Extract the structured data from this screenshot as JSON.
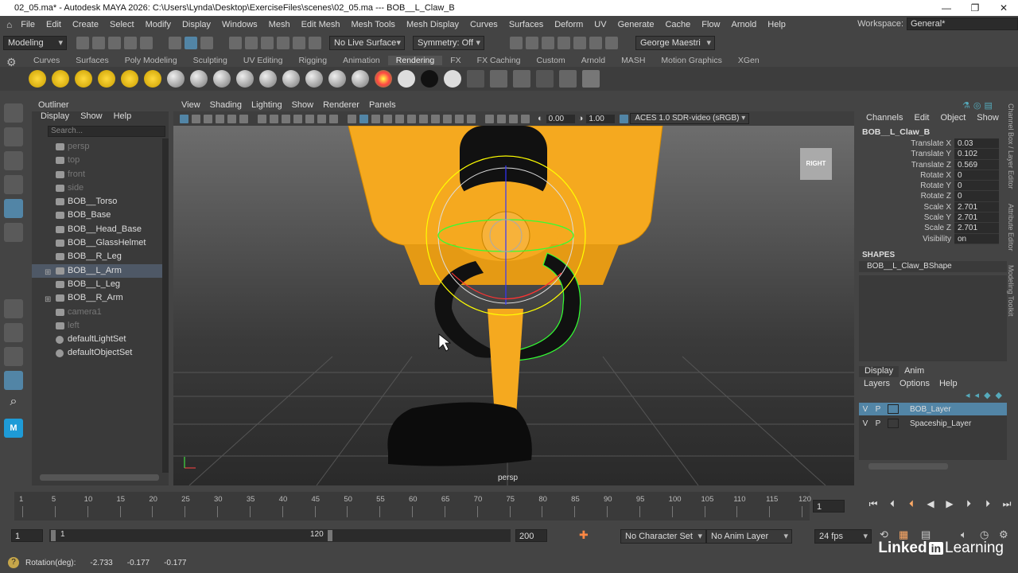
{
  "window": {
    "title": "02_05.ma* - Autodesk MAYA 2026: C:\\Users\\Lynda\\Desktop\\ExerciseFiles\\scenes\\02_05.ma   ---   BOB__L_Claw_B"
  },
  "menubar": [
    "File",
    "Edit",
    "Create",
    "Select",
    "Modify",
    "Display",
    "Windows",
    "Mesh",
    "Edit Mesh",
    "Mesh Tools",
    "Mesh Display",
    "Curves",
    "Surfaces",
    "Deform",
    "UV",
    "Generate",
    "Cache",
    "Flow",
    "Arnold",
    "Help"
  ],
  "workspace": {
    "label": "Workspace:",
    "value": "General*"
  },
  "statusline": {
    "mode": "Modeling",
    "live_surface": "No Live Surface",
    "symmetry": "Symmetry: Off",
    "user": "George Maestri"
  },
  "shelf_tabs": [
    "Curves",
    "Surfaces",
    "Poly Modeling",
    "Sculpting",
    "UV Editing",
    "Rigging",
    "Animation",
    "Rendering",
    "FX",
    "FX Caching",
    "Custom",
    "Arnold",
    "MASH",
    "Motion Graphics",
    "XGen"
  ],
  "active_shelf": "Rendering",
  "outliner": {
    "title": "Outliner",
    "menu": [
      "Display",
      "Show",
      "Help"
    ],
    "search_placeholder": "Search...",
    "items": [
      {
        "label": "persp",
        "dim": true
      },
      {
        "label": "top",
        "dim": true
      },
      {
        "label": "front",
        "dim": true
      },
      {
        "label": "side",
        "dim": true
      },
      {
        "label": "BOB__Torso",
        "dim": false
      },
      {
        "label": "BOB_Base",
        "dim": false
      },
      {
        "label": "BOB__Head_Base",
        "dim": false
      },
      {
        "label": "BOB__GlassHelmet",
        "dim": false
      },
      {
        "label": "BOB__R_Leg",
        "dim": false
      },
      {
        "label": "BOB__L_Arm",
        "dim": false,
        "selected": true
      },
      {
        "label": "BOB__L_Leg",
        "dim": false
      },
      {
        "label": "BOB__R_Arm",
        "dim": false
      },
      {
        "label": "camera1",
        "dim": true
      },
      {
        "label": "left",
        "dim": true
      },
      {
        "label": "defaultLightSet",
        "dim": false
      },
      {
        "label": "defaultObjectSet",
        "dim": false
      }
    ]
  },
  "viewport": {
    "menu": [
      "View",
      "Shading",
      "Lighting",
      "Show",
      "Renderer",
      "Panels"
    ],
    "exposure": "0.00",
    "gamma": "1.00",
    "colorspace": "ACES 1.0 SDR-video (sRGB)",
    "camera_label": "persp",
    "viewcube_label": "RIGHT"
  },
  "channelbox": {
    "menu": [
      "Channels",
      "Edit",
      "Object",
      "Show"
    ],
    "node": "BOB__L_Claw_B",
    "attrs": [
      {
        "name": "Translate X",
        "value": "0.03"
      },
      {
        "name": "Translate Y",
        "value": "0.102"
      },
      {
        "name": "Translate Z",
        "value": "0.569"
      },
      {
        "name": "Rotate X",
        "value": "0"
      },
      {
        "name": "Rotate Y",
        "value": "0"
      },
      {
        "name": "Rotate Z",
        "value": "0"
      },
      {
        "name": "Scale X",
        "value": "2.701"
      },
      {
        "name": "Scale Y",
        "value": "2.701"
      },
      {
        "name": "Scale Z",
        "value": "2.701"
      },
      {
        "name": "Visibility",
        "value": "on"
      }
    ],
    "shapes_title": "SHAPES",
    "shape": "BOB__L_Claw_BShape"
  },
  "layer_editor": {
    "tabs": [
      "Display",
      "Anim"
    ],
    "menu": [
      "Layers",
      "Options",
      "Help"
    ],
    "layers": [
      {
        "v": "V",
        "p": "P",
        "name": "BOB_Layer",
        "selected": true
      },
      {
        "v": "V",
        "p": "P",
        "name": "Spaceship_Layer",
        "selected": false
      }
    ]
  },
  "side_tabs": [
    "Channel Box / Layer Editor",
    "Attribute Editor",
    "Modeling Toolkit"
  ],
  "timeline": {
    "ticks": [
      "1",
      "5",
      "10",
      "15",
      "20",
      "25",
      "30",
      "35",
      "40",
      "45",
      "50",
      "55",
      "60",
      "65",
      "70",
      "75",
      "80",
      "85",
      "90",
      "95",
      "100",
      "105",
      "110",
      "115",
      "120"
    ],
    "current_frame": "1"
  },
  "range": {
    "start": "1",
    "inner_start": "1",
    "inner_end": "120",
    "end": "200",
    "character_set": "No Character Set",
    "anim_layer": "No Anim Layer",
    "fps": "24 fps"
  },
  "helpline": {
    "label": "Rotation(deg):",
    "x": "-2.733",
    "y": "-0.177",
    "z": "-0.177"
  },
  "brand": {
    "left": "Linked",
    "in": "in",
    "right": "Learning"
  }
}
